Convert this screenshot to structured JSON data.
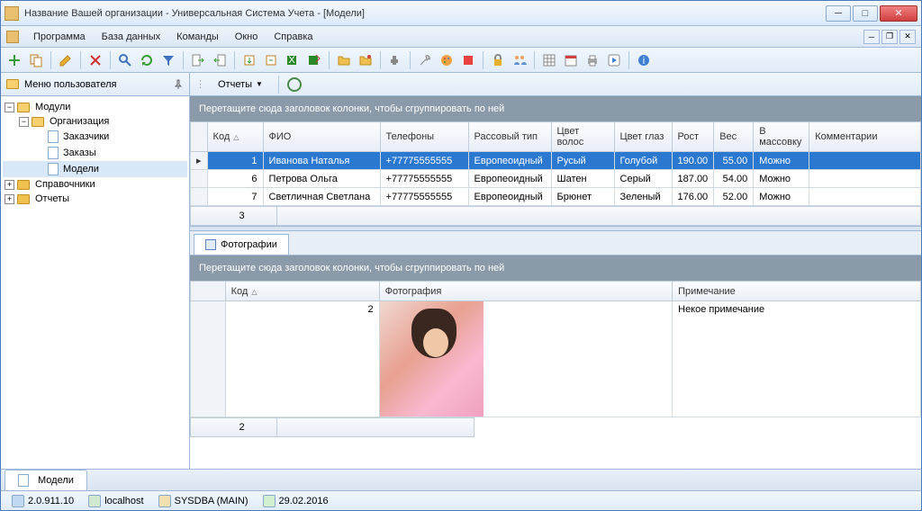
{
  "window": {
    "title": "Название Вашей организации - Универсальная Система Учета - [Модели]"
  },
  "menu": {
    "program": "Программа",
    "database": "База данных",
    "commands": "Команды",
    "window": "Окно",
    "help": "Справка"
  },
  "sidebar": {
    "title": "Меню пользователя",
    "nodes": {
      "modules": "Модули",
      "organization": "Организация",
      "customers": "Заказчики",
      "orders": "Заказы",
      "models": "Модели",
      "reference": "Справочники",
      "reports": "Отчеты"
    }
  },
  "content": {
    "reports_btn": "Отчеты",
    "group_hint": "Перетащите сюда заголовок колонки, чтобы сгруппировать по ней"
  },
  "grid": {
    "headers": {
      "code": "Код",
      "fio": "ФИО",
      "phones": "Телефоны",
      "race": "Рассовый тип",
      "hair": "Цвет волос",
      "eyes": "Цвет глаз",
      "height": "Рост",
      "weight": "Вес",
      "crowd": "В массовку",
      "comments": "Комментарии"
    },
    "rows": [
      {
        "code": "1",
        "fio": "Иванова Наталья",
        "phones": "+77775555555",
        "race": "Европеоидный",
        "hair": "Русый",
        "eyes": "Голубой",
        "height": "190.00",
        "weight": "55.00",
        "crowd": "Можно",
        "comments": ""
      },
      {
        "code": "6",
        "fio": "Петрова Ольга",
        "phones": "+77775555555",
        "race": "Европеоидный",
        "hair": "Шатен",
        "eyes": "Серый",
        "height": "187.00",
        "weight": "54.00",
        "crowd": "Можно",
        "comments": ""
      },
      {
        "code": "7",
        "fio": "Светличная Светлана",
        "phones": "+77775555555",
        "race": "Европеоидный",
        "hair": "Брюнет",
        "eyes": "Зеленый",
        "height": "176.00",
        "weight": "52.00",
        "crowd": "Можно",
        "comments": ""
      }
    ],
    "footer_count": "3"
  },
  "detail": {
    "tab_label": "Фотографии",
    "headers": {
      "code": "Код",
      "photo": "Фотография",
      "note": "Примечание"
    },
    "row": {
      "code": "2",
      "note": "Некое примечание"
    },
    "footer_count": "2"
  },
  "bottom_tab": "Модели",
  "status": {
    "version": "2.0.911.10",
    "host": "localhost",
    "user": "SYSDBA (MAIN)",
    "date": "29.02.2016"
  }
}
